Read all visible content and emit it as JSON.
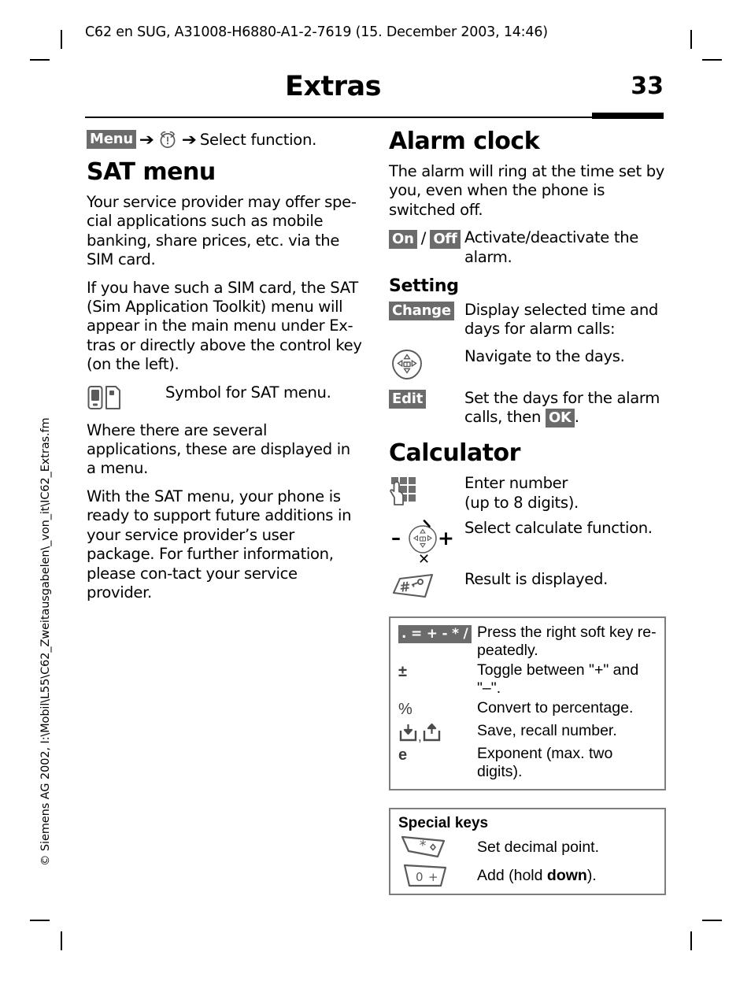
{
  "header": {
    "running_head": "C62 en SUG, A31008-H6880-A1-2-7619 (15. December 2003, 14:46)",
    "title": "Extras",
    "page_number": "33"
  },
  "side_note": "© Siemens AG 2002, I:\\Mobil\\L55\\C62_Zweitausgabelen\\_von_it\\IC62_Extras.fm",
  "left_column": {
    "menu_path": {
      "menu_label": "Menu",
      "arrow1": "➔",
      "alarm_icon": "alarm-clock-icon",
      "arrow2": "➔",
      "tail": "Select function."
    },
    "section_title": "SAT menu",
    "paragraphs": [
      "Your service provider may offer spe-cial applications such as mobile banking, share prices, etc. via the SIM card.",
      "If you have such a SIM card, the SAT (Sim Application Toolkit) menu will appear in the main menu under Ex-tras or directly above the control key (on the left)."
    ],
    "symbol_row": {
      "icon": "phone-sim-icon",
      "text": "Symbol for SAT menu."
    },
    "paragraphs2": [
      "Where there are several applications, these are displayed in a menu.",
      "With the SAT menu, your phone is ready to support future additions in your service provider’s user package. For further information, please con-tact your service provider."
    ]
  },
  "right_column": {
    "alarm": {
      "title": "Alarm clock",
      "intro": "The alarm will ring at the time set by you, even when the phone is switched off.",
      "on_label": "On",
      "separator": "/",
      "off_label": "Off",
      "on_off_desc": "Activate/deactivate the alarm."
    },
    "setting": {
      "title": "Setting",
      "rows": [
        {
          "key_type": "chip",
          "key_label": "Change",
          "icon": "",
          "desc": "Display selected time and days for alarm calls:"
        },
        {
          "key_type": "icon",
          "key_label": "",
          "icon": "control-key-icon",
          "desc": "Navigate to the days."
        },
        {
          "key_type": "chip",
          "key_label": "Edit",
          "icon": "",
          "desc_pre": "Set the days for the alarm calls, then ",
          "desc_chip": "OK",
          "desc_post": "."
        }
      ]
    },
    "calculator": {
      "title": "Calculator",
      "rows": [
        {
          "icon": "keypad-hand-icon",
          "desc": "Enter number\n(up to 8 digits)."
        },
        {
          "icon": "control-key-math-icon",
          "desc": "Select calculate function."
        },
        {
          "icon": "hash-key-icon",
          "desc": "Result is displayed."
        }
      ],
      "keys_table": [
        {
          "key": ". = + - * /",
          "key_type": "chip",
          "desc": "Press the right soft key re-peatedly."
        },
        {
          "key": "±",
          "key_type": "glyph",
          "desc": "Toggle between \"+\" and \"–\"."
        },
        {
          "key": "%",
          "key_type": "glyph",
          "desc": "Convert to percentage."
        },
        {
          "key": "save-recall-icons",
          "key_type": "icon",
          "desc": "Save, recall number."
        },
        {
          "key": "e",
          "key_type": "glyph",
          "desc": "Exponent (max. two digits)."
        }
      ],
      "special_keys": {
        "title": "Special keys",
        "rows": [
          {
            "icon": "star-key-icon",
            "desc": "Set decimal point."
          },
          {
            "icon": "zero-key-icon",
            "desc_pre": "Add (hold ",
            "desc_bold": "down",
            "desc_post": ")."
          }
        ]
      }
    }
  },
  "colors": {
    "chip_bg": "#6b6b6b",
    "box_border": "#7d7d7d",
    "icon_stroke": "#5a5a5a",
    "text": "#000000"
  }
}
